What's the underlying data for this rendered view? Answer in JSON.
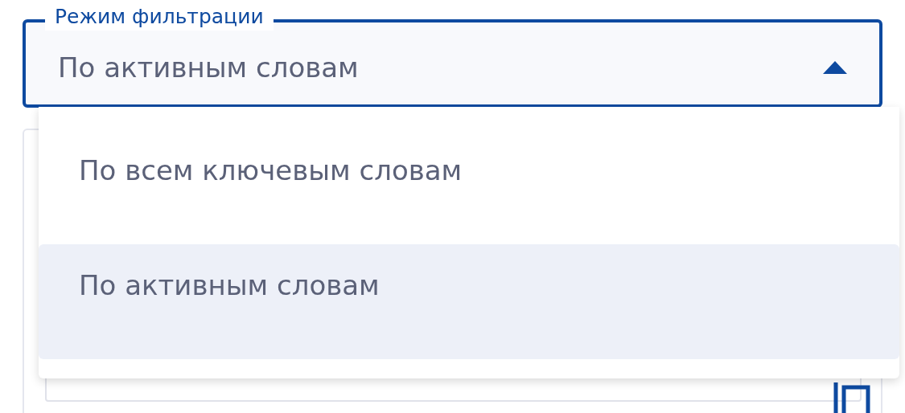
{
  "filter_mode": {
    "label": "Режим фильтрации",
    "value": "По активным словам",
    "expanded": true,
    "options": [
      {
        "label": "По всем ключевым словам",
        "selected": false
      },
      {
        "label": "По активным словам",
        "selected": true
      }
    ]
  }
}
